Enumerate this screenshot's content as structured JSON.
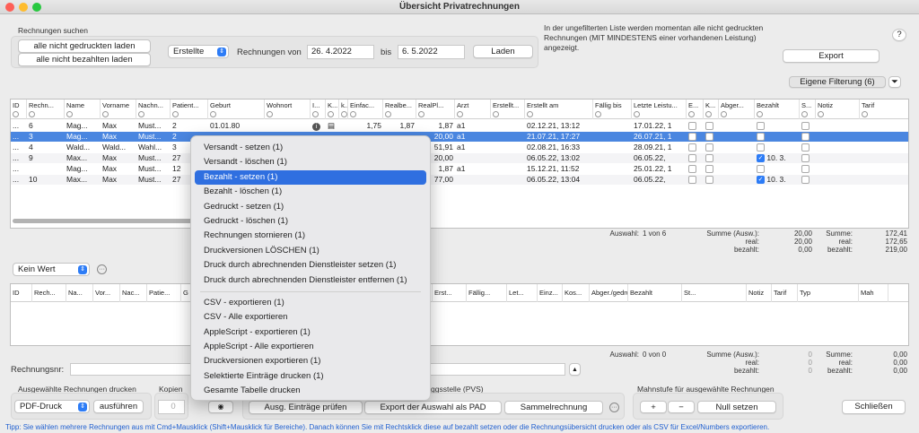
{
  "window": {
    "title": "Übersicht Privatrechnungen"
  },
  "search": {
    "section_label": "Rechnungen suchen",
    "btn_not_printed": "alle nicht gedruckten laden",
    "btn_not_paid": "alle nicht bezahlten laden",
    "filter_select": "Erstellte",
    "von_label": "Rechnungen von",
    "date_from": "26. 4.2022",
    "bis_label": "bis",
    "date_to": "6. 5.2022",
    "load_btn": "Laden"
  },
  "info_text": "In der ungefilterten Liste werden momentan alle nicht gedruckten Rechnungen (MIT MINDESTENS einer vorhandenen Leistung) angezeigt.",
  "help_btn": "?",
  "export_btn": "Export",
  "own_filter_btn": "Eigene Filterung (6)",
  "table1": {
    "headers": [
      "ID",
      "Rechn...",
      "Name",
      "Vorname",
      "Nachn...",
      "Patient...",
      "Geburt",
      "Wohnort",
      "I...",
      "K...",
      "k...",
      "Einfac...",
      "Realbe...",
      "RealPl...",
      "Arzt",
      "Erstellt...",
      "Erstellt am",
      "Fällig bis",
      "Letzte Leistu...",
      "E...",
      "K...",
      "Abger...",
      "Bezahlt",
      "S...",
      "Notiz",
      "Tarif"
    ],
    "rows": [
      {
        "c0": "...",
        "c1": "6",
        "c2": "Mag...",
        "c3": "Max",
        "c4": "Must...",
        "c5": "2",
        "c6": "01.01.80",
        "c11": "1,75",
        "c12": "1,87",
        "c13": "1,87",
        "c14": "a1",
        "c16": "02.12.21, 13:12",
        "c18": "17.01.22, 1"
      },
      {
        "c0": "...",
        "c1": "3",
        "c2": "Mag...",
        "c3": "Max",
        "c4": "Must...",
        "c5": "2",
        "c13": "20,00",
        "c14": "a1",
        "c16": "21.07.21, 17:27",
        "c18": "26.07.21, 1"
      },
      {
        "c0": "...",
        "c1": "4",
        "c2": "Wald...",
        "c3": "Wald...",
        "c4": "Wahl...",
        "c5": "3",
        "c13": "51,91",
        "c14": "a1",
        "c16": "02.08.21, 16:33",
        "c18": "28.09.21, 1"
      },
      {
        "c0": "...",
        "c1": "9",
        "c2": "Max...",
        "c3": "Max",
        "c4": "Must...",
        "c5": "27",
        "c13": "20,00",
        "c16": "06.05.22, 13:02",
        "c18": "06.05.22,",
        "c22": "10. 3."
      },
      {
        "c0": "...",
        "c1": "",
        "c2": "Mag...",
        "c3": "Max",
        "c4": "Must...",
        "c5": "12",
        "c13": "1,87",
        "c14": "a1",
        "c16": "15.12.21, 11:52",
        "c18": "25.01.22, 1"
      },
      {
        "c0": "...",
        "c1": "10",
        "c2": "Max...",
        "c3": "Max",
        "c4": "Must...",
        "c5": "27",
        "c13": "77,00",
        "c16": "06.05.22, 13:04",
        "c18": "06.05.22,",
        "c22": "10. 3."
      }
    ]
  },
  "summary1": {
    "auswahl_label": "Auswahl:",
    "auswahl_value": "1 von 6",
    "summe_label": "Summe (Ausw.):",
    "real_label": "real:",
    "bezahlt_label": "bezahlt:",
    "summe_ausw": "20,00",
    "real_ausw": "20,00",
    "bezahlt_ausw": "0,00",
    "summe_label2": "Summe:",
    "summe": "172,41",
    "real": "172,65",
    "bezahlt": "219,00"
  },
  "wert_select": "Kein Wert",
  "table2": {
    "headers": [
      "ID",
      "Rech...",
      "Na...",
      "Vor...",
      "Nac...",
      "Patie...",
      "G",
      "llt von",
      "Erst...",
      "Fällig...",
      "Let...",
      "Einz...",
      "Kos...",
      "Abger./gedruckt",
      "Bezahlt",
      "St...",
      "Notiz",
      "Tarif",
      "Typ",
      "Mah"
    ]
  },
  "summary2": {
    "auswahl_label": "Auswahl:",
    "auswahl_value": "0 von 0",
    "summe_label": "Summe (Ausw.):",
    "real_label": "real:",
    "bezahlt_label": "bezahlt:",
    "summe_ausw": "0",
    "real_ausw": "0",
    "bezahlt_ausw": "0",
    "summe_label2": "Summe:",
    "summe": "0,00",
    "real": "0,00",
    "bezahlt": "0,00"
  },
  "rechnungsnr_label": "Rechnungsnr:",
  "print": {
    "section_label": "Ausgewählte Rechnungen drucken",
    "select": "PDF-Druck",
    "run_btn": "ausführen",
    "kopien_label": "Kopien",
    "kopien_value": "0",
    "tipp_label": "Tipp"
  },
  "pvs": {
    "section_label": "ggsstelle (PVS)",
    "btn_pruefen": "Ausg. Einträge prüfen",
    "btn_pad": "Export der Auswahl als PAD",
    "btn_sammel": "Sammelrechnung"
  },
  "mahn": {
    "section_label": "Mahnstufe für ausgewählte Rechnungen",
    "plus": "+",
    "minus": "−",
    "null_btn": "Null setzen"
  },
  "close_btn": "Schließen",
  "tip": "Tipp: Sie wählen mehrere Rechnungen aus mit Cmd+Mausklick (Shift+Mausklick für Bereiche). Danach können Sie mit Rechtsklick diese auf bezahlt setzen oder die Rechnungsübersicht drucken oder als CSV für Excel/Numbers exportieren.",
  "context_menu": {
    "group1": [
      "Versandt - setzen (1)",
      "Versandt - löschen (1)",
      "Bezahlt - setzen (1)",
      "Bezahlt - löschen (1)",
      "Gedruckt - setzen (1)",
      "Gedruckt - löschen (1)",
      "Rechnungen stornieren (1)",
      "Druckversionen LÖSCHEN (1)",
      "Druck durch abrechnenden Dienstleister setzen (1)",
      "Druck durch abrechnenden Dienstleister entfernen (1)"
    ],
    "group2": [
      "CSV - exportieren (1)",
      "CSV - Alle exportieren",
      "AppleScript - exportieren (1)",
      "AppleScript - Alle exportieren",
      "Druckversionen exportieren (1)",
      "Selektierte Einträge drucken (1)",
      "Gesamte Tabelle drucken"
    ],
    "highlighted": "Bezahlt - setzen (1)"
  },
  "colors": {
    "accent": "#2f6fe0",
    "selection": "#4a86e0",
    "tip": "#1f5fd0"
  }
}
